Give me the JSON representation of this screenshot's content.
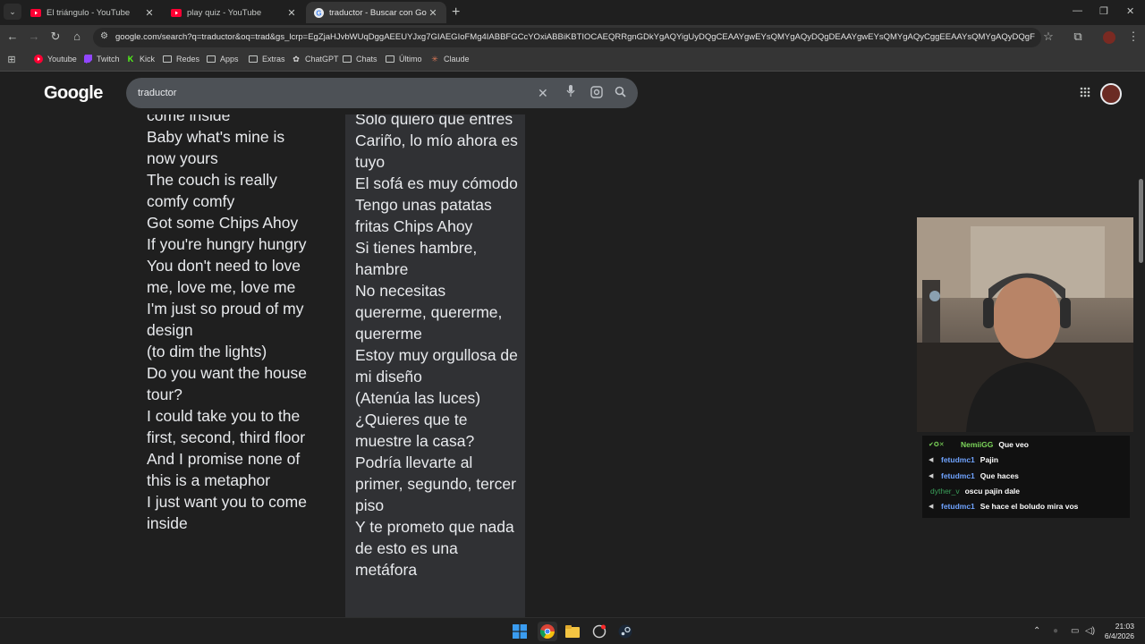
{
  "tabs": [
    {
      "title": "El triángulo - YouTube",
      "icon": "youtube-icon"
    },
    {
      "title": "play quiz - YouTube",
      "icon": "youtube-icon"
    },
    {
      "title": "traductor - Buscar con Google",
      "icon": "google-icon"
    }
  ],
  "address_bar": {
    "url": "google.com/search?q=traductor&oq=trad&gs_lcrp=EgZjaHJvbWUqDggAEEUYJxg7GIAEGIoFMg4IABBFGCcYOxiABBiKBTIOCAEQRRgnGDkYgAQYigUyDQgCEAAYgwEYsQMYgAQyDQgDEAAYgwEYsQMYgAQyCggEEAAYsQMYgAQyDQgFEAAYgwEYsQMYgAQ"
  },
  "bookmarks": [
    {
      "label": "Youtube",
      "icon": "youtube-icon"
    },
    {
      "label": "Twitch",
      "icon": "twitch-icon"
    },
    {
      "label": "Kick",
      "icon": "kick-icon"
    },
    {
      "label": "Redes",
      "icon": "folder-icon"
    },
    {
      "label": "Apps",
      "icon": "folder-icon"
    },
    {
      "label": "Extras",
      "icon": "folder-icon"
    },
    {
      "label": "ChatGPT",
      "icon": "chatgpt-icon"
    },
    {
      "label": "Chats",
      "icon": "folder-icon"
    },
    {
      "label": "Último",
      "icon": "folder-icon"
    },
    {
      "label": "Claude",
      "icon": "claude-icon"
    }
  ],
  "search": {
    "logo": "Google",
    "query": "traductor"
  },
  "lyrics_source": "come inside\nBaby what's mine is now yours\nThe couch is really comfy comfy\nGot some Chips Ahoy\nIf you're hungry hungry\nYou don't need to love me, love me, love me\nI'm just so proud of my design\n(to dim the lights)\nDo you want the house tour?\nI could take you to the first, second, third floor\nAnd I promise none of this is a metaphor\nI just want you to come inside",
  "lyrics_translation": "Solo quiero que entres\nCariño, lo mío ahora es tuyo\nEl sofá es muy cómodo\nTengo unas patatas fritas Chips Ahoy\nSi tienes hambre, hambre\nNo necesitas quererme, quererme, quererme\nEstoy muy orgullosa de mi diseño\n(Atenúa las luces)\n¿Quieres que te muestre la casa?\nPodría llevarte al primer, segundo, tercer piso\nY te prometo que nada de esto es una metáfora",
  "chat": [
    {
      "user": "NemiiGG",
      "message": "Que veo",
      "color": "#7cd65a"
    },
    {
      "user": "fetudmc1",
      "message": "Pajin",
      "color": "#6fa3ff"
    },
    {
      "user": "fetudmc1",
      "message": "Que haces",
      "color": "#6fa3ff"
    },
    {
      "user": "dyther_v",
      "message": "oscu pajin dale",
      "color": "#3aa05a"
    },
    {
      "user": "fetudmc1",
      "message": "Se hace el boludo mira vos",
      "color": "#6fa3ff"
    }
  ],
  "clock": {
    "time": "21:03",
    "date": "6/4/2026"
  },
  "colors": {
    "accent": "#8ab4f8",
    "youtube": "#ff0033",
    "kick": "#53fc18",
    "twitch": "#9146ff"
  }
}
